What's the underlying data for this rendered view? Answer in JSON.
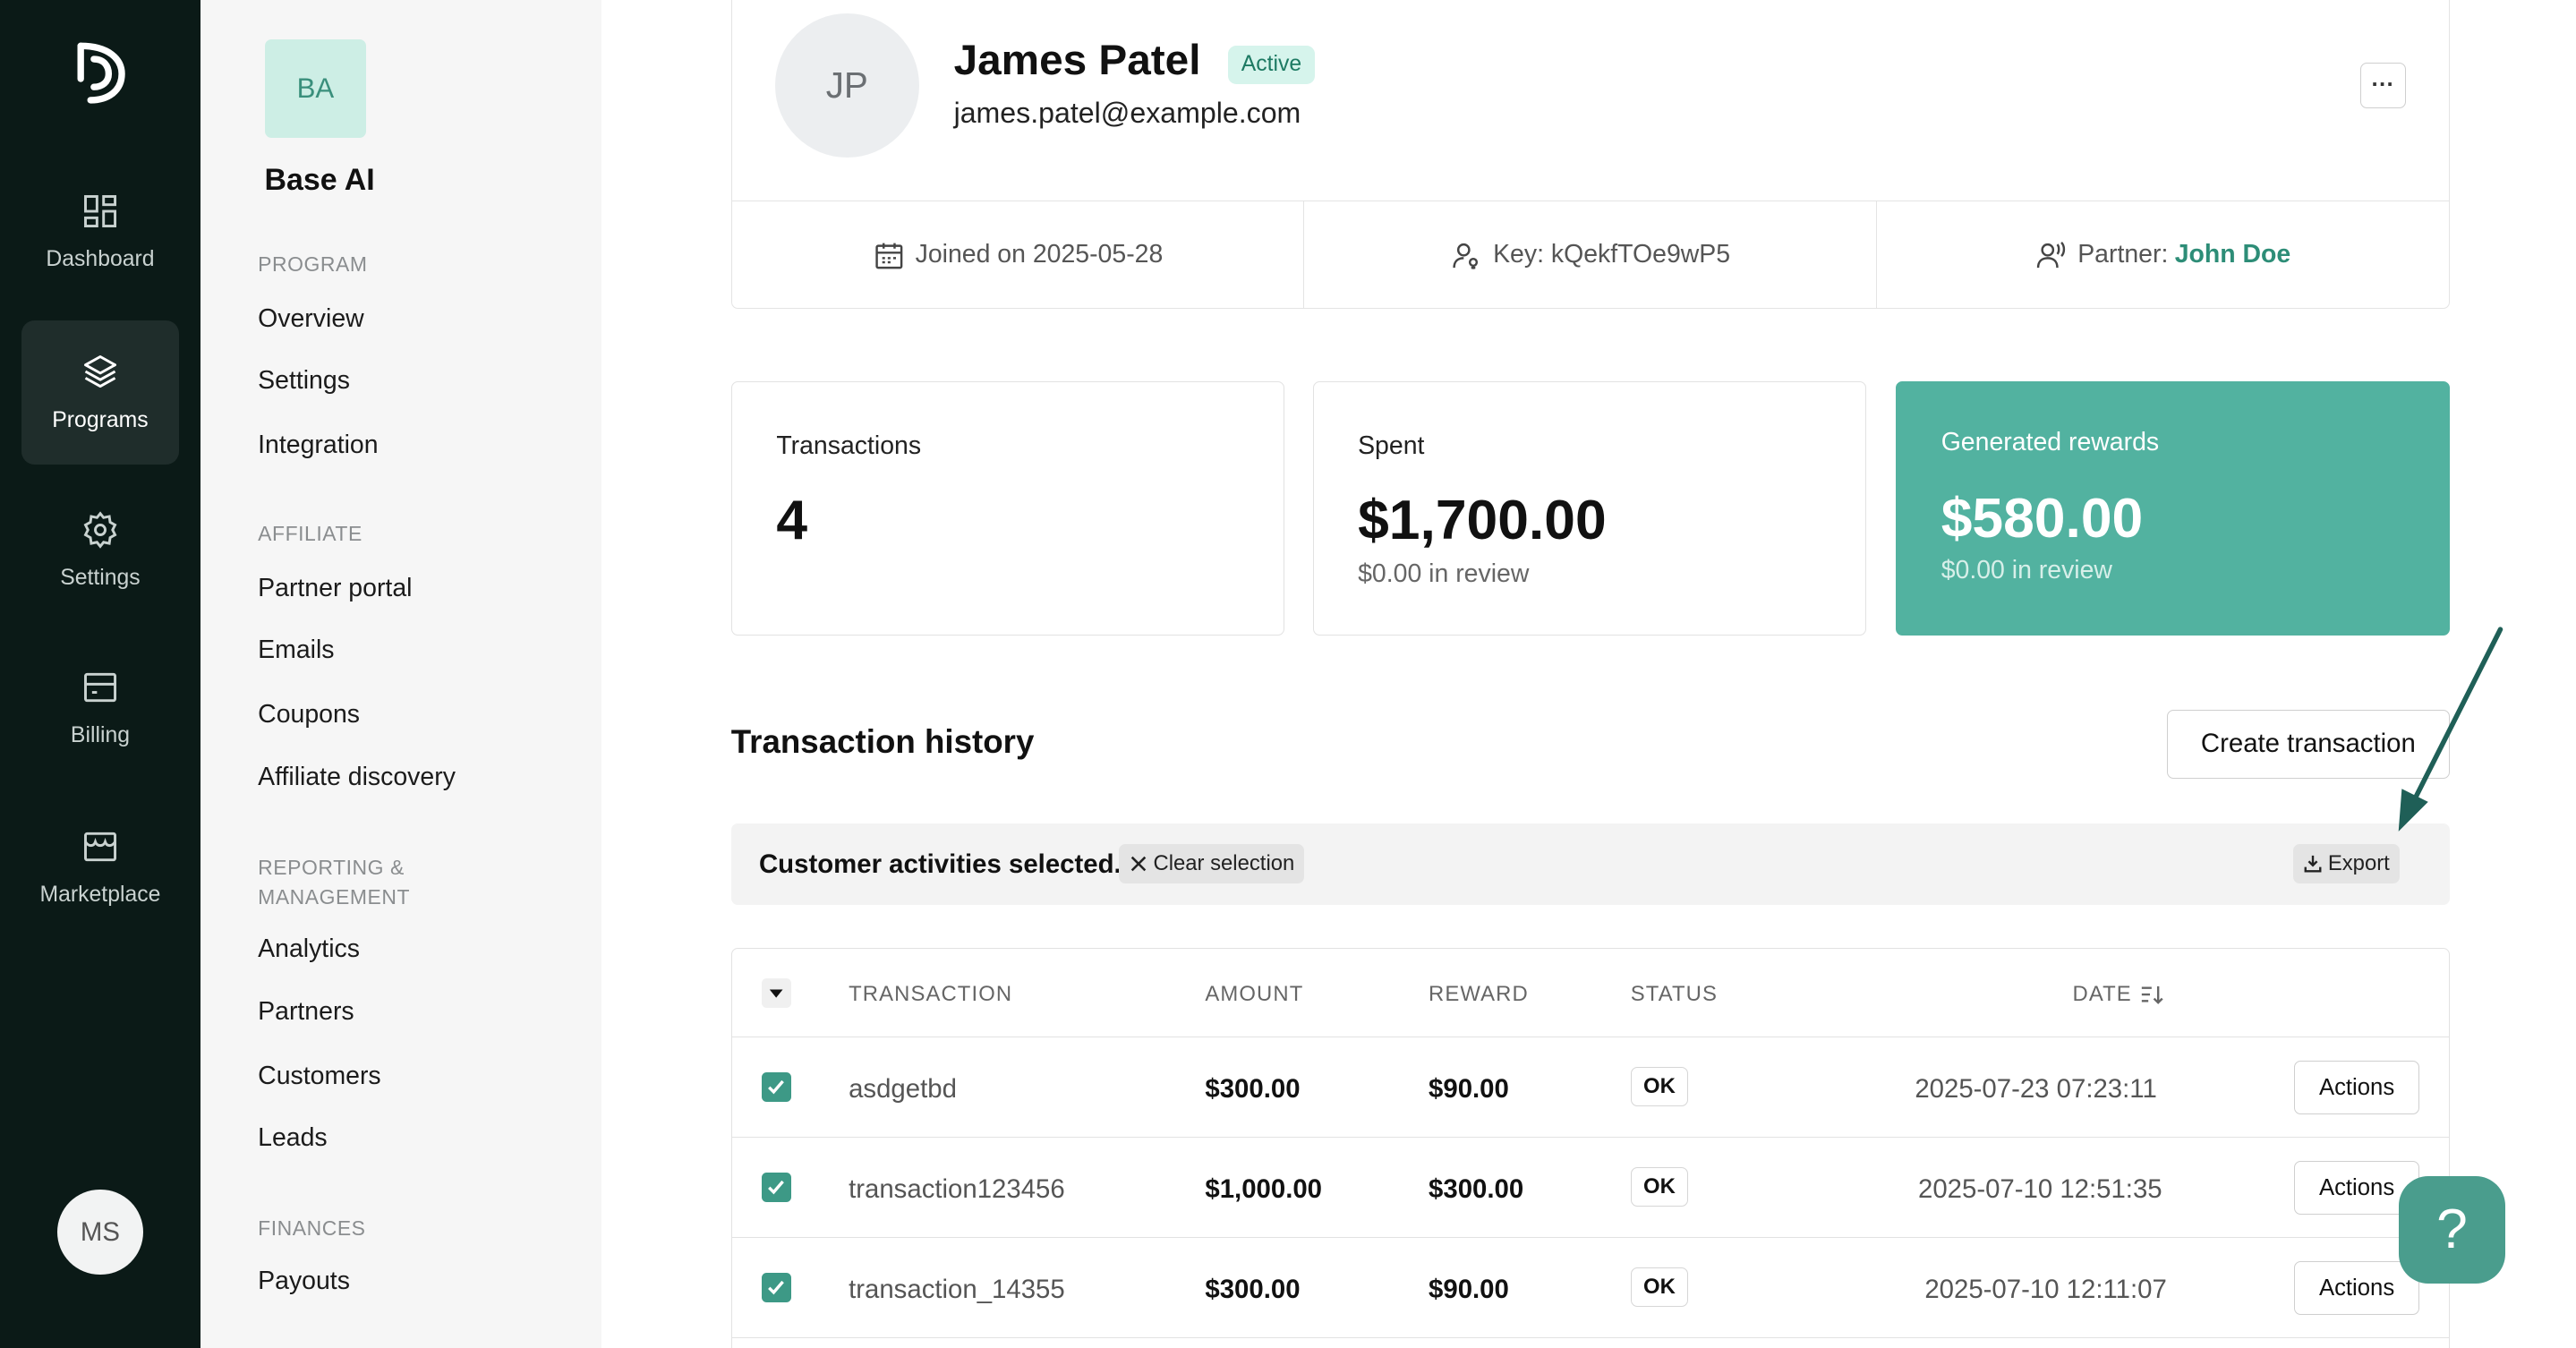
{
  "rail": {
    "items": [
      {
        "label": "Dashboard",
        "icon": "dashboard-icon"
      },
      {
        "label": "Programs",
        "icon": "layers-icon",
        "active": true
      },
      {
        "label": "Settings",
        "icon": "gear-icon"
      },
      {
        "label": "Billing",
        "icon": "billing-icon"
      },
      {
        "label": "Marketplace",
        "icon": "store-icon"
      }
    ],
    "user_initials": "MS"
  },
  "sidebar": {
    "brand_initials": "BA",
    "brand_name": "Base AI",
    "sections": {
      "program": {
        "title": "PROGRAM",
        "items": [
          "Overview",
          "Settings",
          "Integration"
        ]
      },
      "affiliate": {
        "title": "AFFILIATE",
        "items": [
          "Partner portal",
          "Emails",
          "Coupons",
          "Affiliate discovery"
        ]
      },
      "reporting": {
        "title_line1": "REPORTING &",
        "title_line2": "MANAGEMENT",
        "items": [
          "Analytics",
          "Partners",
          "Customers",
          "Leads"
        ]
      },
      "finances": {
        "title": "FINANCES",
        "items": [
          "Payouts"
        ]
      }
    }
  },
  "profile": {
    "initials": "JP",
    "name": "James Patel",
    "status": "Active",
    "email": "james.patel@example.com",
    "more_label": "···",
    "joined": "Joined on 2025-05-28",
    "key": "Key: kQekfTOe9wP5",
    "partner_label": "Partner:",
    "partner_name": "John Doe"
  },
  "stats": {
    "transactions": {
      "label": "Transactions",
      "value": "4"
    },
    "spent": {
      "label": "Spent",
      "value": "$1,700.00",
      "sub": "$0.00 in review"
    },
    "rewards": {
      "label": "Generated rewards",
      "value": "$580.00",
      "sub": "$0.00 in review"
    }
  },
  "history": {
    "title": "Transaction history",
    "create_label": "Create transaction",
    "selection_text": "Customer activities selected.",
    "clear_label": "Clear selection",
    "export_label": "Export",
    "columns": [
      "TRANSACTION",
      "AMOUNT",
      "REWARD",
      "STATUS",
      "DATE"
    ],
    "rows": [
      {
        "id": "asdgetbd",
        "amount": "$300.00",
        "reward": "$90.00",
        "status": "OK",
        "date": "2025-07-23 07:23:11",
        "action": "Actions"
      },
      {
        "id": "transaction123456",
        "amount": "$1,000.00",
        "reward": "$300.00",
        "status": "OK",
        "date": "2025-07-10 12:51:35",
        "action": "Actions"
      },
      {
        "id": "transaction_14355",
        "amount": "$300.00",
        "reward": "$90.00",
        "status": "OK",
        "date": "2025-07-10 12:11:07",
        "action": "Actions"
      }
    ]
  },
  "help": {
    "label": "?"
  },
  "colors": {
    "accent": "#52b2a0",
    "rail_bg": "#0b1a17",
    "link": "#2d8d77"
  }
}
